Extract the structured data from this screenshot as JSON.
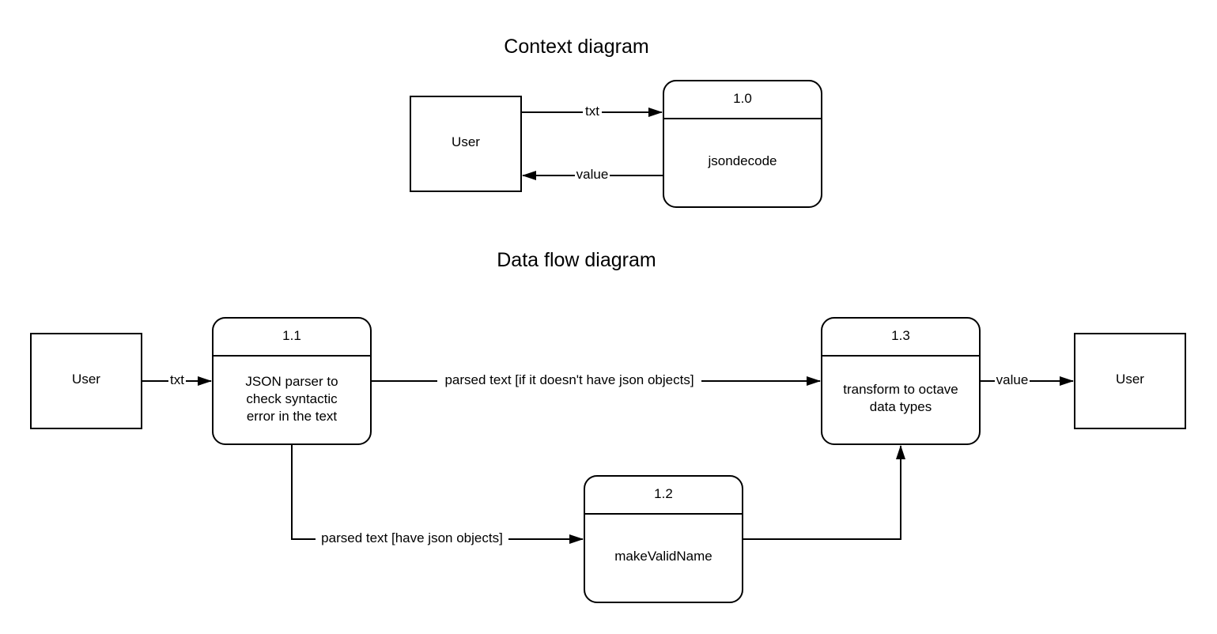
{
  "context_diagram": {
    "title": "Context diagram",
    "entities": [
      {
        "id": "user",
        "label": "User"
      }
    ],
    "processes": [
      {
        "id": "p1_0",
        "number": "1.0",
        "label_lines": [
          "jsondecode"
        ]
      }
    ],
    "flows": [
      {
        "from": "user",
        "to": "p1_0",
        "label": "txt"
      },
      {
        "from": "p1_0",
        "to": "user",
        "label": "value"
      }
    ]
  },
  "data_flow_diagram": {
    "title": "Data flow diagram",
    "entities": [
      {
        "id": "user_in",
        "label": "User"
      },
      {
        "id": "user_out",
        "label": "User"
      }
    ],
    "processes": [
      {
        "id": "p1_1",
        "number": "1.1",
        "label_lines": [
          "JSON parser to",
          "check syntactic",
          "error in the text"
        ]
      },
      {
        "id": "p1_2",
        "number": "1.2",
        "label_lines": [
          "makeValidName"
        ]
      },
      {
        "id": "p1_3",
        "number": "1.3",
        "label_lines": [
          "transform to octave",
          "data types"
        ]
      }
    ],
    "flows": [
      {
        "from": "user_in",
        "to": "p1_1",
        "label": "txt"
      },
      {
        "from": "p1_1",
        "to": "p1_3",
        "label": "parsed text [if it doesn't have json objects]"
      },
      {
        "from": "p1_1",
        "to": "p1_2",
        "label": "parsed text [have json objects]"
      },
      {
        "from": "p1_2",
        "to": "p1_3",
        "label": ""
      },
      {
        "from": "p1_3",
        "to": "user_out",
        "label": "value"
      }
    ]
  }
}
